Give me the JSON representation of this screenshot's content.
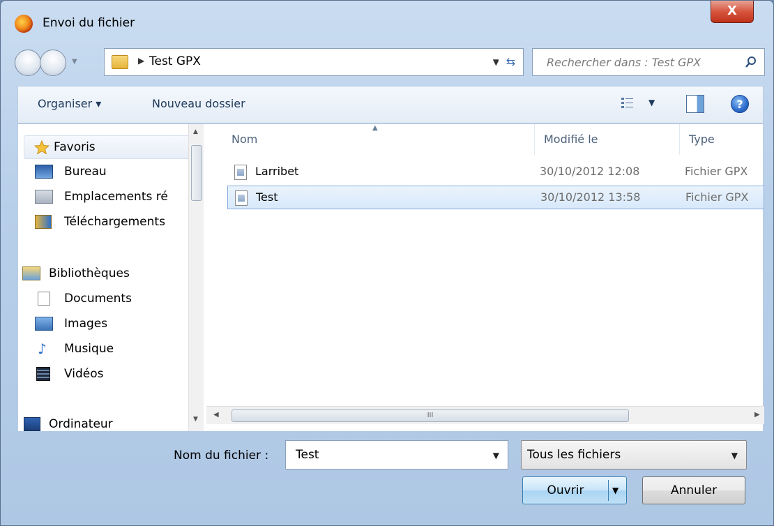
{
  "window": {
    "title": "Envoi du fichier",
    "close_label": "X"
  },
  "address": {
    "path": "Test GPX"
  },
  "search": {
    "placeholder": "Rechercher dans : Test GPX"
  },
  "toolbar": {
    "organize_label": "Organiser ▾",
    "new_folder_label": "Nouveau dossier",
    "help_label": "?"
  },
  "nav": {
    "items": [
      {
        "label": "Favoris",
        "icon": "star-icon"
      },
      {
        "label": "Bureau",
        "icon": "desktop-icon"
      },
      {
        "label": "Emplacements ré",
        "icon": "recent-places-icon"
      },
      {
        "label": "Téléchargements",
        "icon": "downloads-icon"
      },
      {
        "label": "Bibliothèques",
        "icon": "libraries-icon"
      },
      {
        "label": "Documents",
        "icon": "documents-icon"
      },
      {
        "label": "Images",
        "icon": "images-icon"
      },
      {
        "label": "Musique",
        "icon": "music-icon"
      },
      {
        "label": "Vidéos",
        "icon": "videos-icon"
      },
      {
        "label": "Ordinateur",
        "icon": "computer-icon"
      }
    ]
  },
  "files": {
    "columns": [
      "Nom",
      "Modifié le",
      "Type"
    ],
    "rows": [
      {
        "name": "Larribet",
        "modified": "30/10/2012 12:08",
        "type": "Fichier GPX",
        "selected": false
      },
      {
        "name": "Test",
        "modified": "30/10/2012 13:58",
        "type": "Fichier GPX",
        "selected": true
      }
    ]
  },
  "scroll": {
    "grip": "III"
  },
  "bottom": {
    "filename_label": "Nom du fichier :",
    "filename_value": "Test",
    "filetype_value": "Tous les fichiers",
    "open_label": "Ouvrir",
    "cancel_label": "Annuler"
  },
  "colors": {
    "selection": "#d8e9fb",
    "accent": "#3c7fb1"
  }
}
